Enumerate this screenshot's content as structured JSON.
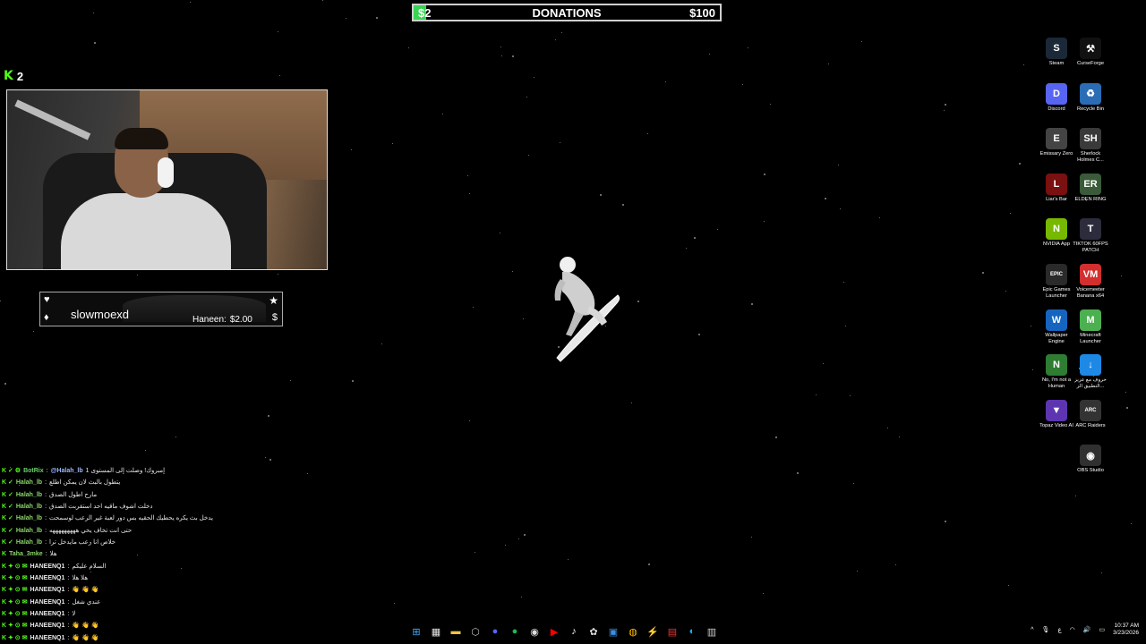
{
  "donations": {
    "left_amount": "$2",
    "title": "DONATIONS",
    "right_amount": "$100",
    "progress": 0.02,
    "accent": "#39d353"
  },
  "stream": {
    "platform_icon": "K",
    "viewer_count": "2"
  },
  "alert": {
    "username": "slowmoexd",
    "donation_label": "Haneen:",
    "donation_amount": "$2.00",
    "heart_icon": "♥",
    "drop_icon": "♦",
    "star_icon": "★",
    "dollar_icon": "$"
  },
  "chat": [
    {
      "badges": "K ✓ ⚙",
      "user": "BotRix",
      "kind": "bot",
      "mention": "@Halah_lb",
      "text": "1 إمبروك! وصلت إلى المستوى"
    },
    {
      "badges": "K ✓",
      "user": "Halah_lb",
      "kind": "user",
      "mention": "",
      "text": "يتطول بالبث لان يمكن اطلع"
    },
    {
      "badges": "K ✓",
      "user": "Halah_lb",
      "kind": "user",
      "mention": "",
      "text": "مارح اطول الصدق"
    },
    {
      "badges": "K ✓",
      "user": "Halah_lb",
      "kind": "user",
      "mention": "",
      "text": "دخلت اشوف ماقيه احد استقربت الصدق"
    },
    {
      "badges": "K ✓",
      "user": "Halah_lb",
      "kind": "user",
      "mention": "",
      "text": "يدخل بث يكره يحطيك الحقيه بس دور لعبة غير الرعب لوسمحت"
    },
    {
      "badges": "K ✓",
      "user": "Halah_lb",
      "kind": "user",
      "mention": "",
      "text": "حتى انت تخاف يخي هههههههههه"
    },
    {
      "badges": "K ✓",
      "user": "Halah_lb",
      "kind": "user",
      "mention": "",
      "text": "خلاص انا رعب مايدخل ترا"
    },
    {
      "badges": "K",
      "user": "Taha_3mke",
      "kind": "user",
      "mention": "",
      "text": "هلا"
    },
    {
      "badges": "K ✦ ⊙ ✉",
      "user": "HANEENQ1",
      "kind": "haneen",
      "mention": "",
      "text": "السلام عليكم"
    },
    {
      "badges": "K ✦ ⊙ ✉",
      "user": "HANEENQ1",
      "kind": "haneen",
      "mention": "",
      "text": "هلا هلا"
    },
    {
      "badges": "K ✦ ⊙ ✉",
      "user": "HANEENQ1",
      "kind": "haneen",
      "mention": "",
      "text": "👋 👋 👋"
    },
    {
      "badges": "K ✦ ⊙ ✉",
      "user": "HANEENQ1",
      "kind": "haneen",
      "mention": "",
      "text": "عندي شغل"
    },
    {
      "badges": "K ✦ ⊙ ✉",
      "user": "HANEENQ1",
      "kind": "haneen",
      "mention": "",
      "text": "لا"
    },
    {
      "badges": "K ✦ ⊙ ✉",
      "user": "HANEENQ1",
      "kind": "haneen",
      "mention": "",
      "text": "👋 👋 👋"
    },
    {
      "badges": "K ✦ ⊙ ✉",
      "user": "HANEENQ1",
      "kind": "haneen",
      "mention": "",
      "text": "👋 👋 👋"
    }
  ],
  "desktop_icons": [
    {
      "label": "Steam",
      "glyph": "S",
      "bg": "#1b2838",
      "col": 0,
      "row": 0
    },
    {
      "label": "CurseForge",
      "glyph": "⚒",
      "bg": "#111111",
      "col": 1,
      "row": 0
    },
    {
      "label": "Discord",
      "glyph": "D",
      "bg": "#5865f2",
      "col": 0,
      "row": 1
    },
    {
      "label": "Recycle Bin",
      "glyph": "♻",
      "bg": "#2a6db5",
      "col": 1,
      "row": 1
    },
    {
      "label": "Emissary Zero",
      "glyph": "E",
      "bg": "#444444",
      "col": 0,
      "row": 2
    },
    {
      "label": "Sherlock Holmes C...",
      "glyph": "SH",
      "bg": "#3a3a3a",
      "col": 1,
      "row": 2
    },
    {
      "label": "Liar's Bar",
      "glyph": "L",
      "bg": "#7a1010",
      "col": 0,
      "row": 3
    },
    {
      "label": "ELDEN RING",
      "glyph": "ER",
      "bg": "#3a5a3a",
      "col": 1,
      "row": 3
    },
    {
      "label": "NVIDIA App",
      "glyph": "N",
      "bg": "#76b900",
      "col": 0,
      "row": 4
    },
    {
      "label": "TIKTOK 60FPS PATCH",
      "glyph": "T",
      "bg": "#2c2c3c",
      "col": 1,
      "row": 4
    },
    {
      "label": "Epic Games Launcher",
      "glyph": "EPIC",
      "bg": "#2a2a2a",
      "col": 0,
      "row": 5
    },
    {
      "label": "Voicemeeter Banana x64",
      "glyph": "VM",
      "bg": "#d32f2f",
      "col": 1,
      "row": 5
    },
    {
      "label": "Wallpaper Engine",
      "glyph": "W",
      "bg": "#1565c0",
      "col": 0,
      "row": 6
    },
    {
      "label": "Minecraft Launcher",
      "glyph": "M",
      "bg": "#4caf50",
      "col": 1,
      "row": 6
    },
    {
      "label": "No, I'm not a Human",
      "glyph": "N",
      "bg": "#2e7d32",
      "col": 0,
      "row": 7
    },
    {
      "label": "حروف مع عزيز التطبيق الر...",
      "glyph": "↓",
      "bg": "#1e88e5",
      "col": 1,
      "row": 7
    },
    {
      "label": "Topaz Video AI",
      "glyph": "▼",
      "bg": "#5e35b1",
      "col": 0,
      "row": 8
    },
    {
      "label": "ARC Raiders",
      "glyph": "ARC",
      "bg": "#333333",
      "col": 1,
      "row": 8
    },
    {
      "label": "OBS Studio",
      "glyph": "◉",
      "bg": "#303030",
      "col": 1,
      "row": 9
    }
  ],
  "taskbar_apps": [
    {
      "name": "start-icon",
      "glyph": "⊞",
      "color": "#4aa8ff"
    },
    {
      "name": "calendar-icon",
      "glyph": "▦",
      "color": "#e6e6e6"
    },
    {
      "name": "file-explorer-icon",
      "glyph": "▬",
      "color": "#f4c542"
    },
    {
      "name": "settings-icon",
      "glyph": "⬡",
      "color": "#bdbdbd"
    },
    {
      "name": "discord-icon",
      "glyph": "●",
      "color": "#5865f2"
    },
    {
      "name": "spotify-icon",
      "glyph": "●",
      "color": "#1db954"
    },
    {
      "name": "obs-icon",
      "glyph": "◉",
      "color": "#dddddd"
    },
    {
      "name": "youtube-icon",
      "glyph": "▶",
      "color": "#ff0000"
    },
    {
      "name": "tiktok-icon",
      "glyph": "♪",
      "color": "#ffffff"
    },
    {
      "name": "chatgpt-icon",
      "glyph": "✿",
      "color": "#dddddd"
    },
    {
      "name": "app-icon",
      "glyph": "▣",
      "color": "#3a8fe0"
    },
    {
      "name": "chrome-icon",
      "glyph": "◍",
      "color": "#fbbc05"
    },
    {
      "name": "app2-icon",
      "glyph": "⚡",
      "color": "#f5a623"
    },
    {
      "name": "app3-icon",
      "glyph": "▤",
      "color": "#e53935"
    },
    {
      "name": "edge-icon",
      "glyph": "◐",
      "color": "#1faee9"
    },
    {
      "name": "app4-icon",
      "glyph": "▥",
      "color": "#cccccc"
    }
  ],
  "tray": {
    "chevron": "^",
    "mic": "🎙",
    "language": "ع",
    "wifi": "◠",
    "volume": "🔊",
    "battery": "▭",
    "time": "10:37 AM",
    "date": "3/23/2026"
  }
}
